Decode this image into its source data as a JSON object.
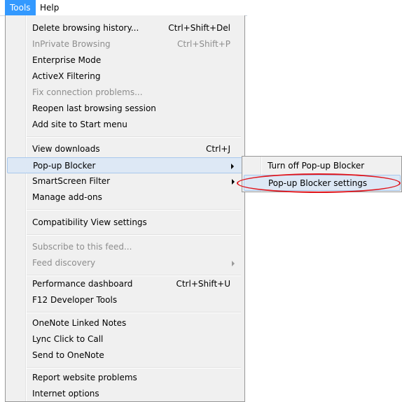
{
  "menubar": {
    "items": [
      {
        "label": "Tools"
      },
      {
        "label": "Help"
      }
    ]
  },
  "menu": {
    "items": [
      {
        "label": "Delete browsing history...",
        "shortcut": "Ctrl+Shift+Del",
        "disabled": false
      },
      {
        "label": "InPrivate Browsing",
        "shortcut": "Ctrl+Shift+P",
        "disabled": true
      },
      {
        "label": "Enterprise Mode",
        "shortcut": "",
        "disabled": false
      },
      {
        "label": "ActiveX Filtering",
        "shortcut": "",
        "disabled": false
      },
      {
        "label": "Fix connection problems...",
        "shortcut": "",
        "disabled": true
      },
      {
        "label": "Reopen last browsing session",
        "shortcut": "",
        "disabled": false
      },
      {
        "label": "Add site to Start menu",
        "shortcut": "",
        "disabled": false
      },
      {
        "label": "View downloads",
        "shortcut": "Ctrl+J",
        "disabled": false
      },
      {
        "label": "Pop-up Blocker",
        "shortcut": "",
        "disabled": false,
        "submenu": true
      },
      {
        "label": "SmartScreen Filter",
        "shortcut": "",
        "disabled": false,
        "submenu": true
      },
      {
        "label": "Manage add-ons",
        "shortcut": "",
        "disabled": false
      },
      {
        "label": "Compatibility View settings",
        "shortcut": "",
        "disabled": false
      },
      {
        "label": "Subscribe to this feed...",
        "shortcut": "",
        "disabled": true
      },
      {
        "label": "Feed discovery",
        "shortcut": "",
        "disabled": true,
        "submenu": true
      },
      {
        "label": "Performance dashboard",
        "shortcut": "Ctrl+Shift+U",
        "disabled": false
      },
      {
        "label": "F12 Developer Tools",
        "shortcut": "",
        "disabled": false
      },
      {
        "label": "OneNote Linked Notes",
        "shortcut": "",
        "disabled": false
      },
      {
        "label": "Lync Click to Call",
        "shortcut": "",
        "disabled": false
      },
      {
        "label": "Send to OneNote",
        "shortcut": "",
        "disabled": false
      },
      {
        "label": "Report website problems",
        "shortcut": "",
        "disabled": false
      },
      {
        "label": "Internet options",
        "shortcut": "",
        "disabled": false
      }
    ]
  },
  "submenu": {
    "items": [
      {
        "label": "Turn off Pop-up Blocker"
      },
      {
        "label": "Pop-up Blocker settings"
      }
    ]
  },
  "colors": {
    "menubar_active": "#3399ff",
    "hover_fill": "#dde8f5",
    "annotation": "#e0141b"
  }
}
